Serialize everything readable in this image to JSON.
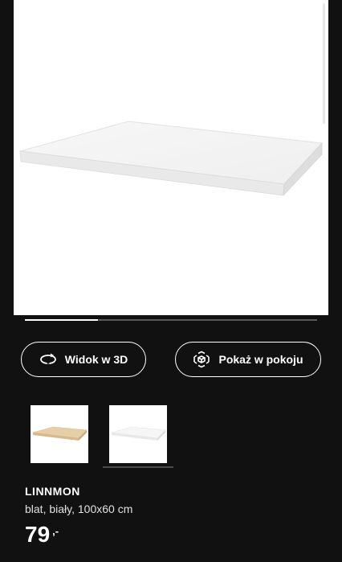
{
  "gallery": {
    "progress_fraction": 0.25
  },
  "actions": {
    "view_3d_label": "Widok w 3D",
    "show_in_room_label": "Pokaż w pokoju"
  },
  "product": {
    "name": "LINNMON",
    "description": "blat, biały, 100x60 cm",
    "price": "79",
    "price_suffix": ",-"
  },
  "icons": {
    "view_3d": "rotate-3d-icon",
    "show_in_room": "ar-cube-icon"
  },
  "colors": {
    "background": "#111111",
    "foreground": "#ffffff",
    "track": "#5a5a5a"
  }
}
